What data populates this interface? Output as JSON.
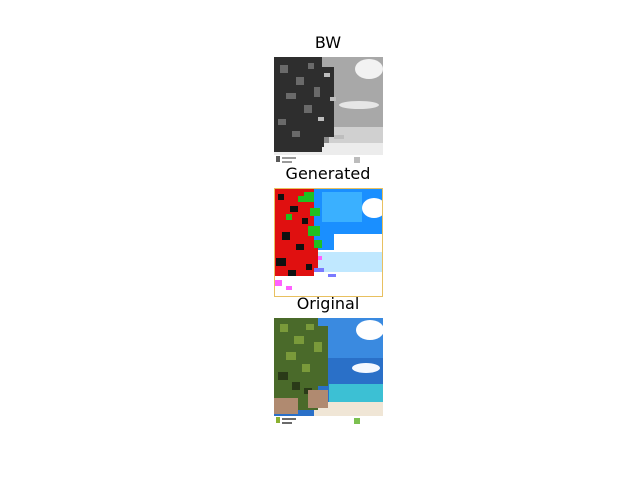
{
  "figure": {
    "panels": [
      {
        "title": "BW",
        "image": "grayscale-beach-palm-photo",
        "palette": {
          "sky": "#9a9a9a",
          "sea": "#d8d8d8",
          "sand": "#f0f0f0",
          "tree": "#3a3a3a",
          "cloud": "#ffffff"
        }
      },
      {
        "title": "Generated",
        "image": "colorized-beach-palm-photo",
        "palette": {
          "sky": "#1a8fff",
          "sea": "#ffffff",
          "sand": "#ffffff",
          "tree": "#e01010",
          "leaf": "#20c020",
          "cloud": "#ffffff"
        }
      },
      {
        "title": "Original",
        "image": "color-beach-palm-photo",
        "palette": {
          "sky": "#2a78d0",
          "sea": "#40c0d8",
          "sand": "#f0e8d8",
          "tree": "#4a6a2a",
          "cloud": "#ffffff"
        }
      }
    ]
  }
}
